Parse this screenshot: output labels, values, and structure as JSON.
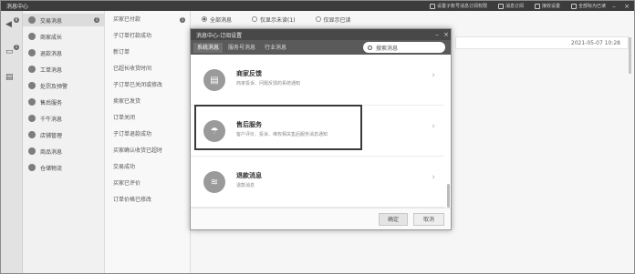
{
  "titlebar": {
    "title": "消息中心",
    "items": [
      "设置子账号消息订阅权限",
      "消息订阅",
      "接收设置",
      "全部标为已读"
    ]
  },
  "rail": {
    "badges": [
      "6",
      "1"
    ]
  },
  "categories": [
    {
      "label": "交易消息",
      "badge": "1",
      "active": true
    },
    {
      "label": "商家成长"
    },
    {
      "label": "退款消息"
    },
    {
      "label": "工单消息"
    },
    {
      "label": "处罚及预警"
    },
    {
      "label": "售后服务"
    },
    {
      "label": "千牛消息"
    },
    {
      "label": "店铺管理"
    },
    {
      "label": "商品消息"
    },
    {
      "label": "仓储物流"
    }
  ],
  "sub_items": [
    {
      "label": "买家已付款",
      "badge": "1"
    },
    {
      "label": "子订单打款成功"
    },
    {
      "label": "新订单"
    },
    {
      "label": "已超长收货时间"
    },
    {
      "label": "子订单已关闭或修改"
    },
    {
      "label": "卖家已发货"
    },
    {
      "label": "订单关闭"
    },
    {
      "label": "子订单退款成功"
    },
    {
      "label": "买家确认收货已超时"
    },
    {
      "label": "交易成功"
    },
    {
      "label": "买家已评价"
    },
    {
      "label": "订单价格已修改"
    }
  ],
  "filters": [
    {
      "label": "全部消息",
      "selected": true
    },
    {
      "label": "仅显示未读(1)",
      "selected": false
    },
    {
      "label": "仅显示已读",
      "selected": false
    }
  ],
  "message_timestamp": "2021-05-07 10:28",
  "modal": {
    "title": "消息中心-订阅设置",
    "tabs": [
      {
        "label": "系统消息",
        "active": true
      },
      {
        "label": "服务号消息"
      },
      {
        "label": "行业消息"
      }
    ],
    "search_placeholder": "搜索消息",
    "items": [
      {
        "name": "商家反馈",
        "desc": "商家投诉、问题反馈的系统通知",
        "icon": "document-icon"
      },
      {
        "name": "售后服务",
        "desc": "客户评价、投诉、维权相关售后服务消息通知",
        "icon": "umbrella-icon"
      },
      {
        "name": "退款消息",
        "desc": "退款消息",
        "icon": "coins-icon"
      }
    ],
    "ok_label": "确定",
    "cancel_label": "取消"
  }
}
